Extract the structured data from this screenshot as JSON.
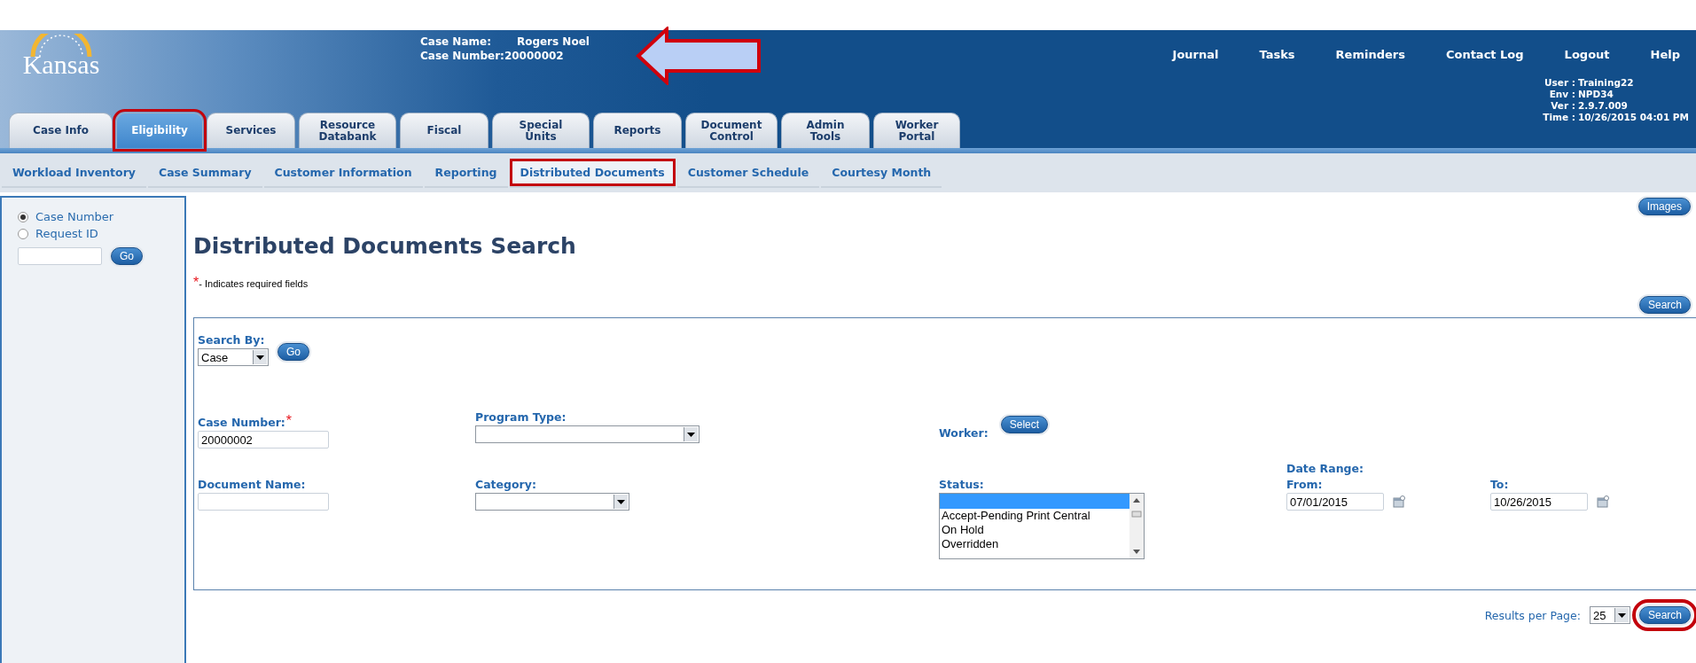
{
  "header": {
    "logo_text": "Kansas",
    "case_name_label": "Case Name:",
    "case_name": "Rogers Noel",
    "case_number_label": "Case Number:",
    "case_number": "20000002"
  },
  "top_links": [
    "Journal",
    "Tasks",
    "Reminders",
    "Contact Log",
    "Logout",
    "Help"
  ],
  "session_info": [
    {
      "label": "User :",
      "value": "Training22"
    },
    {
      "label": "Env :",
      "value": "NPD34"
    },
    {
      "label": "Ver :",
      "value": "2.9.7.009"
    },
    {
      "label": "Time :",
      "value": "10/26/2015 04:01 PM"
    }
  ],
  "tabs": [
    {
      "lines": [
        "Case Info"
      ],
      "selected": false,
      "annotated": false
    },
    {
      "lines": [
        "Eligibility"
      ],
      "selected": true,
      "annotated": true
    },
    {
      "lines": [
        "Services"
      ],
      "selected": false,
      "annotated": false
    },
    {
      "lines": [
        "Resource",
        "Databank"
      ],
      "selected": false,
      "annotated": false
    },
    {
      "lines": [
        "Fiscal"
      ],
      "selected": false,
      "annotated": false
    },
    {
      "lines": [
        "Special",
        "Units"
      ],
      "selected": false,
      "annotated": false
    },
    {
      "lines": [
        "Reports"
      ],
      "selected": false,
      "annotated": false
    },
    {
      "lines": [
        "Document",
        "Control"
      ],
      "selected": false,
      "annotated": false
    },
    {
      "lines": [
        "Admin",
        "Tools"
      ],
      "selected": false,
      "annotated": false
    },
    {
      "lines": [
        "Worker",
        "Portal"
      ],
      "selected": false,
      "annotated": false
    }
  ],
  "subnav": [
    {
      "label": "Workload Inventory",
      "selected": false,
      "annotated": false
    },
    {
      "label": "Case Summary",
      "selected": false,
      "annotated": false
    },
    {
      "label": "Customer Information",
      "selected": false,
      "annotated": false
    },
    {
      "label": "Reporting",
      "selected": false,
      "annotated": false
    },
    {
      "label": "Distributed Documents",
      "selected": true,
      "annotated": true
    },
    {
      "label": "Customer Schedule",
      "selected": false,
      "annotated": false
    },
    {
      "label": "Courtesy Month",
      "selected": false,
      "annotated": false
    }
  ],
  "sidebar": {
    "options": [
      {
        "label": "Case Number",
        "selected": true
      },
      {
        "label": "Request ID",
        "selected": false
      }
    ],
    "go_button": "Go"
  },
  "page": {
    "title": "Distributed Documents Search",
    "required_mark": "*",
    "required_note": "- Indicates required fields",
    "images_button": "Images",
    "search_button": "Search"
  },
  "form": {
    "search_by": {
      "label": "Search By:",
      "value": "Case",
      "go_button": "Go"
    },
    "case_number": {
      "label": "Case Number:",
      "required_mark": "*",
      "value": "20000002"
    },
    "program_type": {
      "label": "Program Type:"
    },
    "worker": {
      "label": "Worker:",
      "select_button": "Select"
    },
    "document_name": {
      "label": "Document Name:"
    },
    "category": {
      "label": "Category:"
    },
    "status": {
      "label": "Status:",
      "blank_option_selected": true,
      "options": [
        "Accept-Pending Print Central",
        "On Hold",
        "Overridden"
      ]
    },
    "date_range": {
      "label": "Date Range:",
      "from_label": "From:",
      "from_value": "07/01/2015",
      "to_label": "To:",
      "to_value": "10/26/2015"
    }
  },
  "footer": {
    "results_label": "Results per Page:",
    "results_value": "25",
    "search_button": "Search",
    "search_annotated": true
  }
}
